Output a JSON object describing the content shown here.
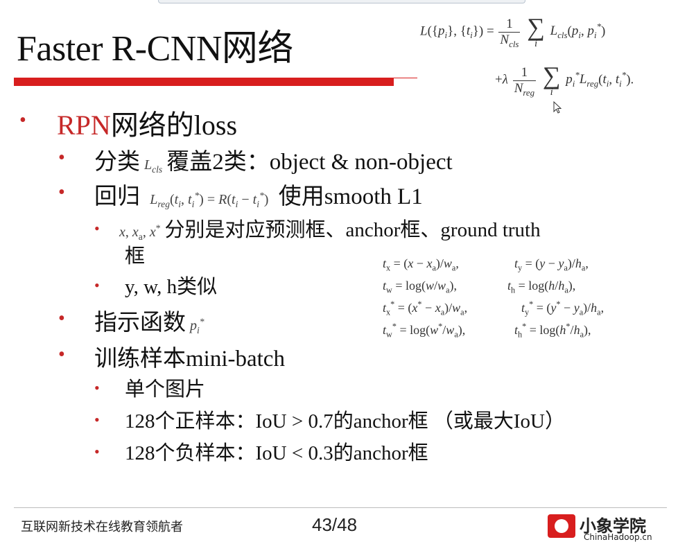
{
  "slide": {
    "title": "Faster R-CNN网络",
    "loss_formula": {
      "lhs": "L({p",
      "line2_prefix": "+λ"
    },
    "bullets": {
      "rpn_prefix": "RPN",
      "rpn_suffix": "网络的loss",
      "cls_prefix": "分类",
      "cls_suffix": "覆盖2类：object & non-object",
      "reg_prefix": "回归",
      "reg_suffix": "使用smooth L1",
      "xvars_text": "分别是对应预测框、anchor框、ground truth",
      "xvars_cont": "框",
      "yvars": "y, w, h类似",
      "indicator": "指示函数",
      "minibatch": "训练样本mini-batch",
      "single_image": "单个图片",
      "positive": "128个正样本：IoU > 0.7的anchor框 （或最大IoU）",
      "negative": "128个负样本：IoU < 0.3的anchor框"
    }
  },
  "footer": {
    "tagline": "互联网新技术在线教育领航者",
    "page": "43/48",
    "logo_text": "小象学院",
    "logo_sub": "ChinaHadoop.cn"
  },
  "colors": {
    "accent_red": "#d81e1e",
    "bullet_red": "#c62828"
  }
}
